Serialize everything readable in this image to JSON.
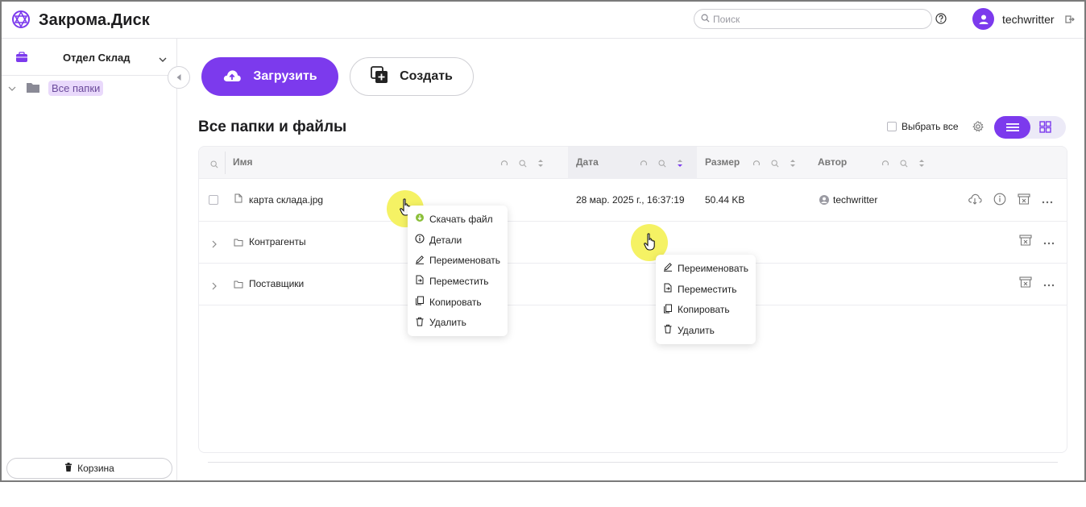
{
  "app": {
    "title": "Закрома.Диск"
  },
  "header": {
    "search_placeholder": "Поиск",
    "user_name": "techwritter"
  },
  "sidebar": {
    "department": "Отдел Склад",
    "tree_root": "Все папки",
    "trash_label": "Корзина"
  },
  "toolbar": {
    "upload_label": "Загрузить",
    "create_label": "Создать"
  },
  "main": {
    "title": "Все папки и файлы",
    "select_all_label": "Выбрать все"
  },
  "table": {
    "columns": [
      "Имя",
      "Дата",
      "Размер",
      "Автор"
    ],
    "rows": [
      {
        "name": "карта склада.jpg",
        "type": "file",
        "date": "28 мар. 2025 г., 16:37:19",
        "size": "50.44 KB",
        "author": "techwritter"
      },
      {
        "name": "Контрагенты",
        "type": "folder",
        "date": "",
        "size": "",
        "author": ""
      },
      {
        "name": "Поставщики",
        "type": "folder",
        "date": "",
        "size": "",
        "author": ""
      }
    ]
  },
  "file_menu": {
    "items": [
      "Скачать файл",
      "Детали",
      "Переименовать",
      "Переместить",
      "Копировать",
      "Удалить"
    ]
  },
  "folder_menu": {
    "items": [
      "Переименовать",
      "Переместить",
      "Копировать",
      "Удалить"
    ]
  },
  "colors": {
    "accent": "#7c3aed",
    "selected_tree_bg": "#e9d9fb",
    "cursor_highlight": "#f5f264"
  }
}
